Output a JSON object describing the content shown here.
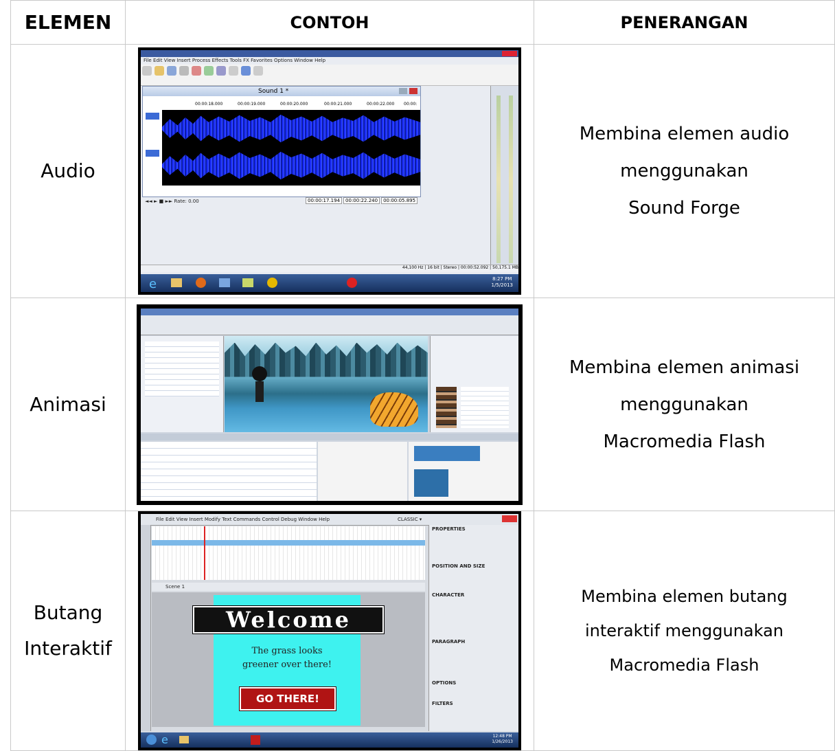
{
  "headers": {
    "elemen": "ELEMEN",
    "contoh": "CONTOH",
    "penerangan": "PENERANGAN"
  },
  "rows": [
    {
      "elemen": "Audio",
      "penerangan": [
        "Membina elemen audio",
        "menggunakan",
        "Sound Forge"
      ],
      "screenshot": {
        "menu": "File  Edit  View  Insert  Process  Effects  Tools  FX Favorites  Options  Window  Help",
        "window_title": "Sound 1 *",
        "time_labels": [
          "00:00:18.000",
          "00:00:19.000",
          "00:00:20.000",
          "00:00:21.000",
          "00:00:22.000",
          "00:00:"
        ],
        "rate": "Rate: 0.00",
        "time_fields": [
          "00:00:17.194",
          "00:00:22.240",
          "00:00:05.895"
        ],
        "status": [
          "44,100 Hz",
          "16 bit",
          "Stereo",
          "00:00:52.092",
          "50,175.1 MB"
        ],
        "clock": [
          "8:27 PM",
          "1/5/2013"
        ]
      }
    },
    {
      "elemen": "Animasi",
      "penerangan": [
        "Membina elemen animasi",
        "menggunakan",
        "Macromedia Flash"
      ]
    },
    {
      "elemen": [
        "Butang",
        "Interaktif"
      ],
      "penerangan": [
        "Membina elemen butang",
        "interaktif  menggunakan",
        "Macromedia Flash"
      ],
      "screenshot": {
        "menu": "File  Edit  View  Insert  Modify  Text  Commands  Control  Debug  Window  Help",
        "workspace": "CLASSIC ▾",
        "scene": "Scene 1",
        "welcome": "Welcome",
        "line1": "The grass looks",
        "line2": "greener over there!",
        "button": "GO THERE!",
        "panel_title": "PROPERTIES",
        "sections": [
          "POSITION AND SIZE",
          "CHARACTER",
          "PARAGRAPH",
          "OPTIONS",
          "FILTERS"
        ],
        "clock": [
          "12:48 PM",
          "1/26/2013"
        ]
      }
    }
  ],
  "colors": {
    "border": "#c9c9c9",
    "wave": "#1a2cff",
    "cyan": "#3ef2ef",
    "go_button": "#b01414"
  }
}
